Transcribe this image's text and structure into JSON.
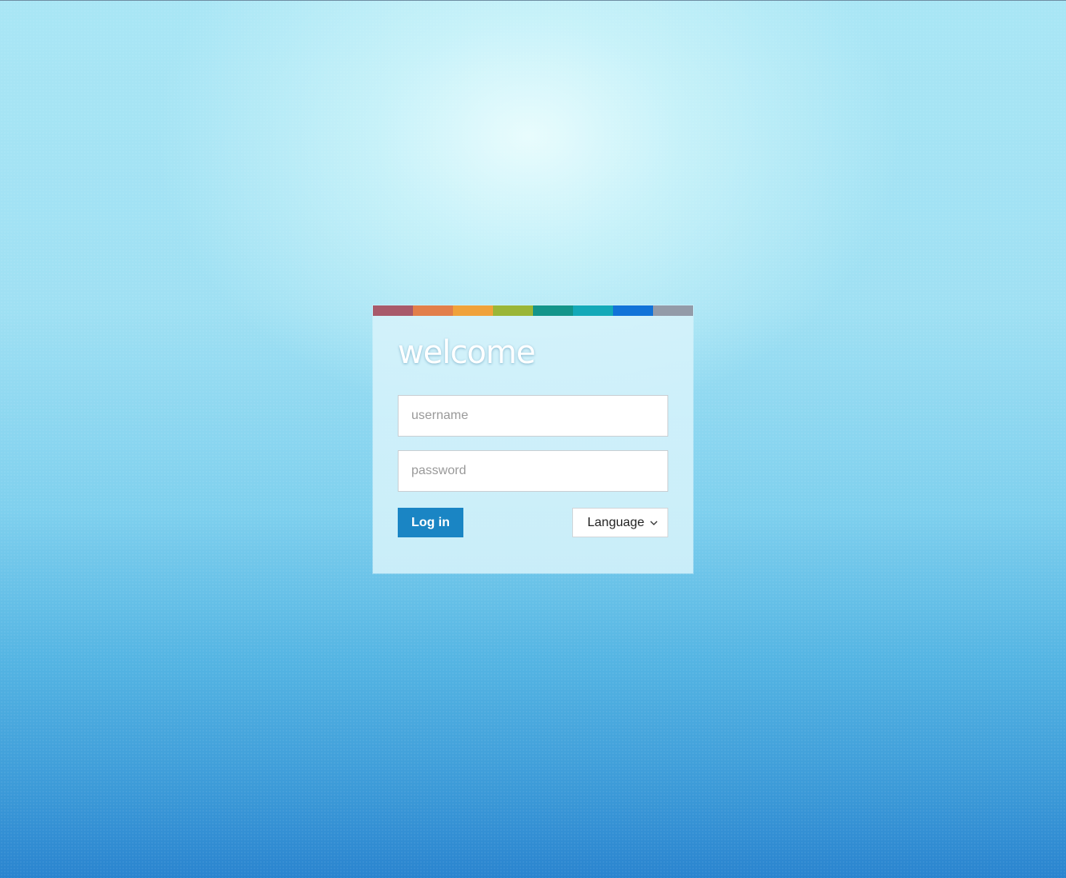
{
  "login": {
    "heading": "welcome",
    "username_placeholder": "username",
    "password_placeholder": "password",
    "login_label": "Log in",
    "language_label": "Language"
  },
  "icons": {
    "language_dropdown": "chevron-down-icon"
  },
  "colors": {
    "accent_button": "#1a85c4",
    "color_bar": [
      "#a85a6a",
      "#e27f4a",
      "#f0a23a",
      "#9ab637",
      "#13958a",
      "#13a9b8",
      "#1173d8",
      "#939ba8"
    ]
  }
}
